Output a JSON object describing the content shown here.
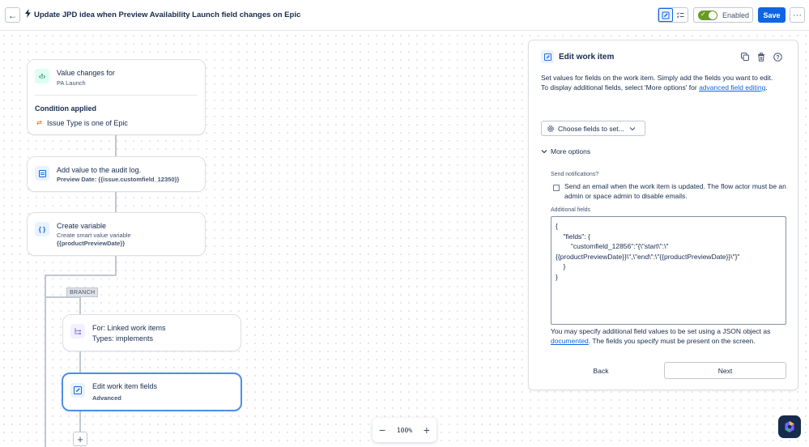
{
  "header": {
    "title": "Update JPD idea when Preview Availability Launch field changes on Epic",
    "enabled_label": "Enabled",
    "save_label": "Save"
  },
  "flow": {
    "trigger": {
      "title": "Value changes for",
      "subtitle": "PA Launch",
      "condition_heading": "Condition applied",
      "condition_text": "Issue Type is one of Epic"
    },
    "audit": {
      "title": "Add value to the audit log.",
      "subtitle": "Preview Date: {{issue.customfield_12350}}"
    },
    "variable": {
      "title": "Create variable",
      "subtitle1": "Create smart value variable",
      "subtitle2": "{{productPreviewDate}}"
    },
    "branch_tag": "BRANCH",
    "linked": {
      "title": "For: Linked work items",
      "subtitle": "Types: implements"
    },
    "edit": {
      "title": "Edit work item fields",
      "subtitle": "Advanced"
    }
  },
  "zoom": {
    "value": "100%"
  },
  "panel": {
    "title": "Edit work item",
    "desc_line1": "Set values for fields on the work item. Simply add the fields you want to edit.",
    "desc_line2_prefix": "To display additional fields, select 'More options' for ",
    "desc_link": "advanced field editing",
    "desc_line2_suffix": ".",
    "choose_fields_label": "Choose fields to set...",
    "more_options_label": "More options",
    "send_notifications_label": "Send notifications?",
    "send_notifications_text": "Send an email when the work item is updated. The flow actor must be an admin or space admin to disable emails.",
    "additional_fields_label": "Additional fields",
    "additional_fields_value": "{\n    \"fields\": {\n        \"customfield_12856\":\"{\\\"start\\\":\\\"\n{{productPreviewDate}}\\\",\\\"end\\\":\\\"{{productPreviewDate}}\\\"}\"\n    }\n}",
    "help_prefix": "You may specify additional field values to be set using a JSON object as ",
    "help_link": "documented",
    "help_suffix": ". The fields you specify must be present on the screen.",
    "back_label": "Back",
    "next_label": "Next"
  },
  "colors": {
    "primary": "#0c66e4",
    "enabled_green": "#6a9a23",
    "selected_border": "#4c8fe8"
  }
}
